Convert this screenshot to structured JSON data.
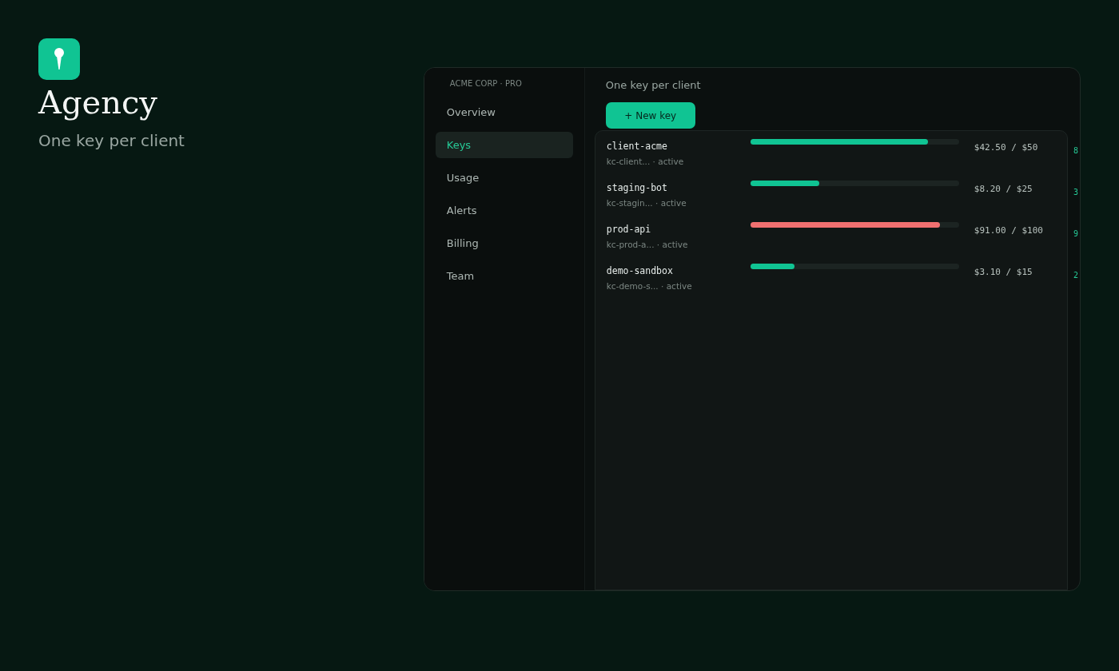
{
  "hero": {
    "title": "Agency",
    "subtitle": "One key per client"
  },
  "app": {
    "sidebar": {
      "org": "ACME CORP · PRO",
      "items": [
        {
          "label": "Overview",
          "selected": false
        },
        {
          "label": "Keys",
          "selected": true
        },
        {
          "label": "Usage",
          "selected": false
        },
        {
          "label": "Alerts",
          "selected": false
        },
        {
          "label": "Billing",
          "selected": false
        },
        {
          "label": "Team",
          "selected": false
        }
      ]
    },
    "subtitle": "One key per client",
    "new_key_button": "+ New key",
    "keys": [
      {
        "name": "client-acme",
        "meta": "kc-client... · active",
        "level": 0.85,
        "color": "#10c493",
        "spend": "$42.50 / $50",
        "percent": "8"
      },
      {
        "name": "staging-bot",
        "meta": "kc-stagin... · active",
        "level": 0.33,
        "color": "#10c493",
        "spend": "$8.20 / $25",
        "percent": "3"
      },
      {
        "name": "prod-api",
        "meta": "kc-prod-a... · active",
        "level": 0.91,
        "color": "#f07070",
        "spend": "$91.00 / $100",
        "percent": "9"
      },
      {
        "name": "demo-sandbox",
        "meta": "kc-demo-s... · active",
        "level": 0.21,
        "color": "#10c493",
        "spend": "$3.10 / $15",
        "percent": "2"
      }
    ]
  }
}
